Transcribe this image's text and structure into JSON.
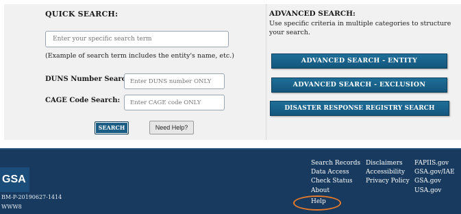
{
  "quick_search": {
    "title": "QUICK SEARCH:",
    "term_placeholder": "Enter your specific search term",
    "example_text": "(Example of search term includes the entity's name, etc.)",
    "duns_label": "DUNS Number Search:",
    "duns_placeholder": "Enter DUNS number ONLY",
    "cage_label": "CAGE Code Search:",
    "cage_placeholder": "Enter CAGE code ONLY",
    "search_button": "SEARCH",
    "help_button": "Need Help?"
  },
  "advanced_search": {
    "title": "ADVANCED SEARCH:",
    "description": "Use specific criteria in multiple categories to structure your search.",
    "buttons": [
      "ADVANCED SEARCH - ENTITY",
      "ADVANCED SEARCH - EXCLUSION",
      "DISASTER RESPONSE REGISTRY SEARCH"
    ]
  },
  "footer": {
    "logo": "GSA",
    "build_id": "BM-P-20190627-1414",
    "server": "WWW8",
    "col1": [
      "Search Records",
      "Data Access",
      "Check Status",
      "About",
      "Help"
    ],
    "col2": [
      "Disclaimers",
      "Accessibility",
      "Privacy Policy"
    ],
    "col3": [
      "FAPIIS.gov",
      "GSA.gov/IAE",
      "GSA.gov",
      "USA.gov"
    ],
    "highlight_color": "#e87b2a"
  }
}
